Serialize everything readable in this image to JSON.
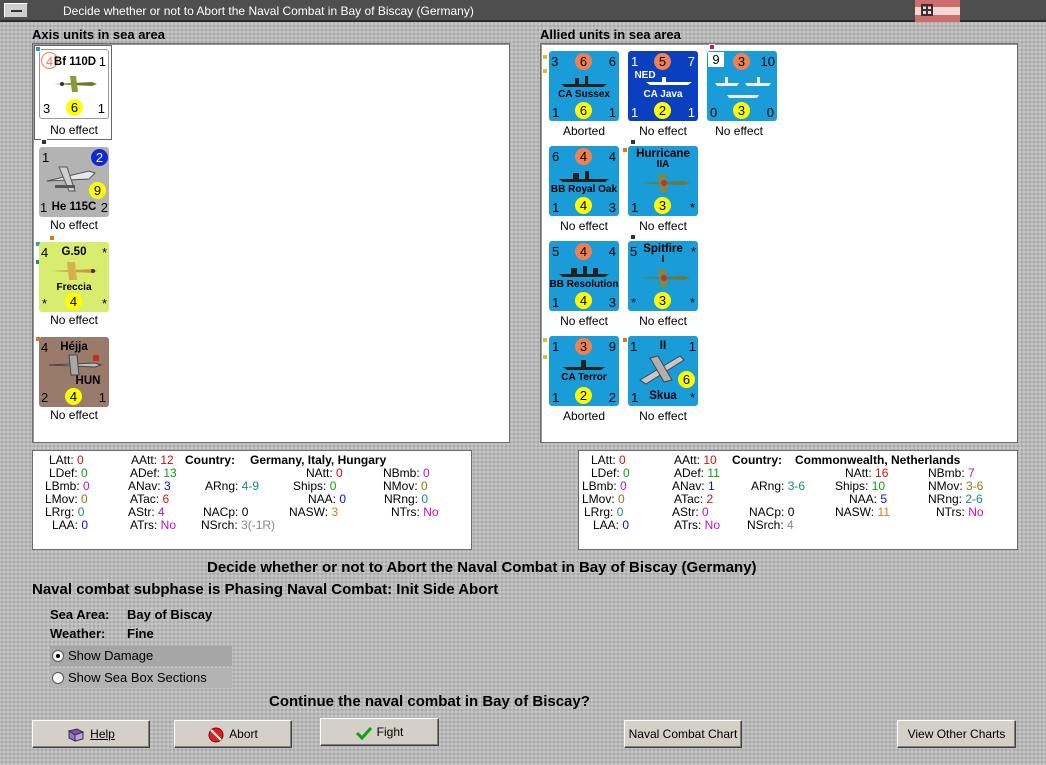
{
  "window": {
    "title": "Decide whether or not to Abort the Naval Combat in Bay of Biscay (Germany)"
  },
  "axis": {
    "title": "Axis units in sea area",
    "units": [
      {
        "name": "Bf 110D",
        "tl": "4",
        "tr": "1",
        "bl": "3",
        "bm": "6",
        "br": "1",
        "status": "No effect",
        "bg": "#ffffff"
      },
      {
        "name": "He 115C",
        "tl": "1",
        "tr": "2",
        "bl": "1",
        "bm": "9",
        "br": "2",
        "status": "No effect",
        "bg": "#b3b3b3"
      },
      {
        "name": "G.50",
        "name2": "Freccia",
        "tl": "4",
        "tr": "*",
        "bl": "*",
        "bm": "4",
        "br": "*",
        "status": "No effect",
        "bg": "#d8ec70"
      },
      {
        "name": "Héjja",
        "name2": "HUN",
        "tl": "4",
        "tr": "",
        "bl": "2",
        "bm": "4",
        "br": "1",
        "status": "No effect",
        "bg": "#9a7a6a"
      }
    ]
  },
  "allied": {
    "title": "Allied units in sea area",
    "units": [
      {
        "name": "CA Sussex",
        "tl": "3",
        "tm": "6",
        "tr": "6",
        "bl": "1",
        "bm": "6",
        "br": "1",
        "status": "Aborted",
        "bg": "#1a9cd8"
      },
      {
        "name": "CA Java",
        "tag": "NED",
        "tl": "1",
        "tm": "5",
        "tr": "7",
        "bl": "1",
        "bm": "2",
        "br": "1",
        "status": "No effect",
        "bg": "#0a40c0"
      },
      {
        "name": "",
        "tl": "9",
        "tm": "3",
        "tr": "10",
        "bl": "0",
        "bm": "3",
        "br": "0",
        "status": "No effect",
        "bg": "#1a9cd8"
      },
      {
        "name": "BB Royal Oak",
        "tl": "6",
        "tm": "4",
        "tr": "4",
        "bl": "1",
        "bm": "4",
        "br": "3",
        "status": "No effect",
        "bg": "#1a9cd8"
      },
      {
        "name": "Hurricane",
        "name2": "IIA",
        "tl": "",
        "tr": "",
        "bl": "1",
        "bm": "3",
        "br": "*",
        "status": "No effect",
        "bg": "#1a9cd8"
      },
      {
        "name": "BB Resolution",
        "tl": "5",
        "tm": "4",
        "tr": "4",
        "bl": "1",
        "bm": "4",
        "br": "3",
        "status": "No effect",
        "bg": "#1a9cd8"
      },
      {
        "name": "Spitfire",
        "name2": "I",
        "tl": "5",
        "tr": "*",
        "bl": "*",
        "bm": "3",
        "br": "*",
        "status": "No effect",
        "bg": "#1a9cd8"
      },
      {
        "name": "CA Terror",
        "tl": "1",
        "tm": "3",
        "tr": "9",
        "bl": "1",
        "bm": "2",
        "br": "2",
        "status": "Aborted",
        "bg": "#1a9cd8"
      },
      {
        "name": "Skua",
        "name2": "II",
        "tl": "1",
        "tr": "1",
        "bl": "1",
        "bm": "6",
        "br": "*",
        "status": "No effect",
        "bg": "#1a9cd8"
      }
    ]
  },
  "axis_stats": {
    "LAtt": "0",
    "LDef": "0",
    "LBmb": "0",
    "LMov": "0",
    "LRrg": "0",
    "LAA": "0",
    "AAtt": "12",
    "ADef": "13",
    "ANav": "3",
    "ATac": "6",
    "AStr": "4",
    "ATrs": "No",
    "country_label": "Country:",
    "country": "Germany, Italy, Hungary",
    "ARng": "4-9",
    "NACp": "0",
    "NSrch": "3(-1R)",
    "NAtt": "0",
    "Ships": "0",
    "NAA": "0",
    "NASW": "3",
    "NBmb": "0",
    "NMov": "0",
    "NRng": "0",
    "NTrs": "No"
  },
  "allied_stats": {
    "LAtt": "0",
    "LDef": "0",
    "LBmb": "0",
    "LMov": "0",
    "LRrg": "0",
    "LAA": "0",
    "AAtt": "10",
    "ADef": "11",
    "ANav": "1",
    "ATac": "2",
    "AStr": "0",
    "ATrs": "No",
    "country_label": "Country:",
    "country": "Commonwealth, Netherlands",
    "ARng": "3-6",
    "NACp": "0",
    "NSrch": "4",
    "NAtt": "16",
    "Ships": "10",
    "NAA": "5",
    "NASW": "11",
    "NBmb": "7",
    "NMov": "3-6",
    "NRng": "2-6",
    "NTrs": "No"
  },
  "labels": {
    "LAtt": "LAtt:",
    "LDef": "LDef:",
    "LBmb": "LBmb:",
    "LMov": "LMov:",
    "LRrg": "LRrg:",
    "LAA": "LAA:",
    "AAtt": "AAtt:",
    "ADef": "ADef:",
    "ANav": "ANav:",
    "ATac": "ATac:",
    "AStr": "AStr:",
    "ATrs": "ATrs:",
    "ARng": "ARng:",
    "NACp": "NACp:",
    "NSrch": "NSrch:",
    "NAtt": "NAtt:",
    "Ships": "Ships:",
    "NAA": "NAA:",
    "NASW": "NASW:",
    "NBmb": "NBmb:",
    "NMov": "NMov:",
    "NRng": "NRng:",
    "NTrs": "NTrs:"
  },
  "main": {
    "heading": "Decide whether or not to Abort the Naval Combat in Bay of Biscay (Germany)",
    "subphase": "Naval combat subphase is Phasing Naval Combat: Init Side Abort",
    "sea_area_label": "Sea Area:",
    "sea_area": "Bay of Biscay",
    "weather_label": "Weather:",
    "weather": "Fine",
    "show_damage": "Show Damage",
    "show_sea_box": "Show Sea Box Sections",
    "question": "Continue the naval combat in Bay of Biscay?"
  },
  "buttons": {
    "help": "Help",
    "abort": "Abort",
    "fight": "Fight",
    "naval_chart": "Naval Combat Chart",
    "other_charts": "View Other Charts"
  }
}
